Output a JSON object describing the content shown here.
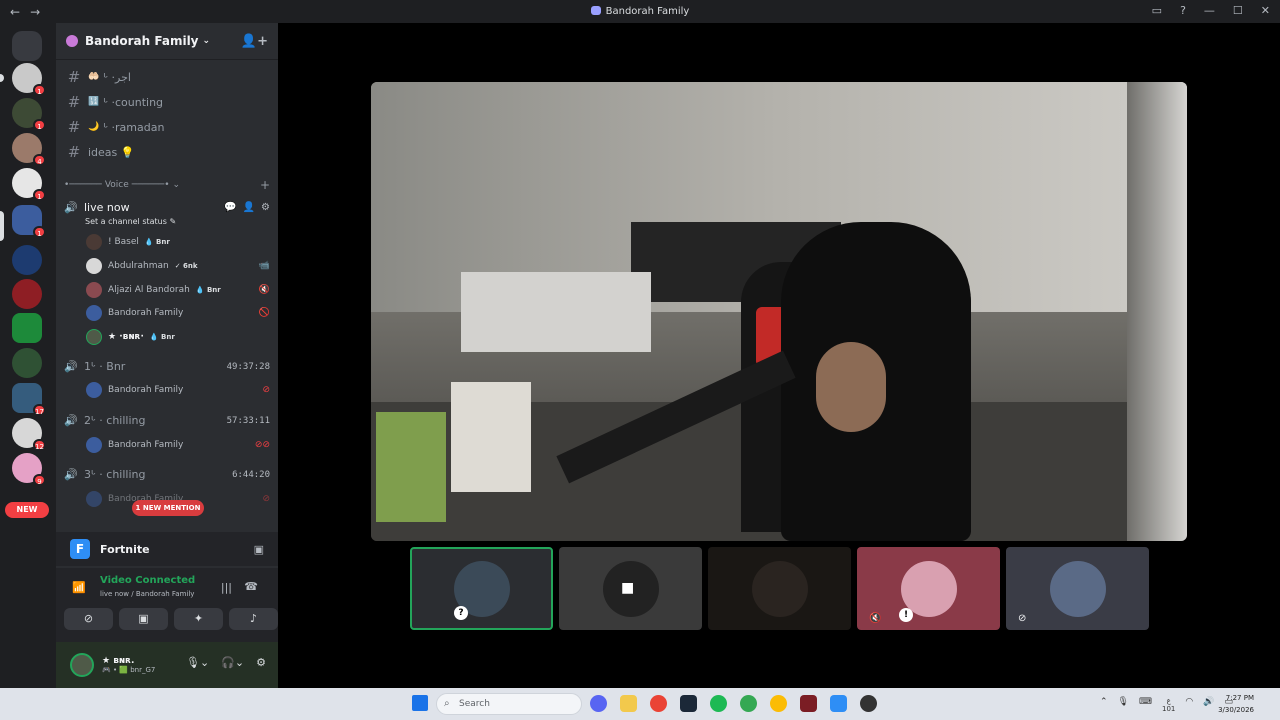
{
  "window": {
    "title": "Bandorah Family",
    "back_icon": "←",
    "forward_icon": "→"
  },
  "servers": {
    "badges": [
      "1",
      "1",
      "4",
      "1",
      "1",
      "",
      "",
      "",
      "",
      "17",
      "12",
      "9"
    ],
    "new_label": "NEW"
  },
  "server_header": {
    "name": "Bandorah Family"
  },
  "text_channels": [
    {
      "emoji": "🤲🏻",
      "prefix": "ᒡ · ",
      "name": "اجر"
    },
    {
      "emoji": "🔢",
      "prefix": "ᒡ · ",
      "name": "counting"
    },
    {
      "emoji": "🌙",
      "prefix": "ᒡ · ",
      "name": "ramadan"
    },
    {
      "emoji": "",
      "prefix": "",
      "name": "ideas 💡"
    }
  ],
  "voice_category": {
    "label": "Voice"
  },
  "live_channel": {
    "name": "live now",
    "status_placeholder": "Set a channel status",
    "members": [
      {
        "name": "! Basel",
        "tag": "💧 Bnr",
        "right": ""
      },
      {
        "name": "Abdulrahman",
        "tag": "✓ 6nk",
        "right": "📹"
      },
      {
        "name": "Aljazi Al Bandorah",
        "tag": "💧 Bnr",
        "right": "🔇"
      },
      {
        "name": "Bandorah Family",
        "tag": "",
        "right": "🚫"
      },
      {
        "name": "★ ·ʙɴʀ·",
        "tag": "💧 Bnr",
        "right": ""
      }
    ]
  },
  "voice_channels": [
    {
      "name": "1ᒡ · Bnr",
      "time": "49:37:28",
      "member": "Bandorah Family"
    },
    {
      "name": "2ᒡ · chilling",
      "time": "57:33:11",
      "member": "Bandorah Family"
    },
    {
      "name": "3ᒡ · chilling",
      "time": "6:44:20",
      "member": "Bandorah Family"
    }
  ],
  "mention_pill": "1 NEW MENTION",
  "activity": {
    "game": "Fortnite"
  },
  "voice_panel": {
    "status": "Video Connected",
    "location": "live now / Bandorah Family"
  },
  "user": {
    "name": "★ ʙɴʀ.",
    "status": "🎮 • 🟩 bnr_G7"
  },
  "taskbar": {
    "search_placeholder": "Search",
    "lang": "ع",
    "lang_sub": "101",
    "time": "7:27 PM",
    "date": "3/30/2026"
  },
  "colors": {
    "accent_green": "#23a55a",
    "danger": "#f23f43",
    "sidebar": "#2b2d31"
  }
}
